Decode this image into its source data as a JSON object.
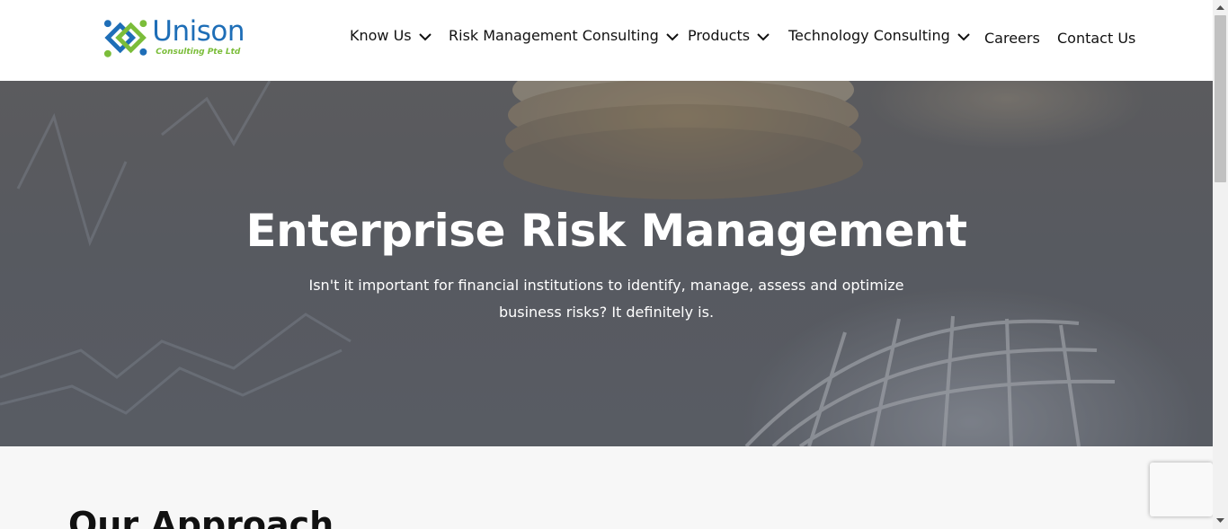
{
  "brand": {
    "name": "Unison",
    "tagline": "Consulting Pte Ltd",
    "colors": {
      "blue": "#1e6eb7",
      "green": "#7bbd3a"
    }
  },
  "nav": {
    "items": [
      {
        "label": "Know Us",
        "has_dropdown": true
      },
      {
        "label": "Risk Management Consulting",
        "has_dropdown": true
      },
      {
        "label": "Products",
        "has_dropdown": true
      },
      {
        "label": "Technology Consulting",
        "has_dropdown": true
      },
      {
        "label": "Careers",
        "has_dropdown": false
      },
      {
        "label": "Contact Us",
        "has_dropdown": false
      }
    ]
  },
  "hero": {
    "title": "Enterprise Risk Management",
    "subtitle": "Isn't it important for financial institutions to identify, manage, assess and optimize business risks? It definitely is."
  },
  "section": {
    "heading": "Our Approach"
  },
  "icons": {
    "chevron": "chevron-down-icon",
    "scroll_up": "scroll-up-arrow-icon",
    "scroll_down": "scroll-down-arrow-icon"
  }
}
